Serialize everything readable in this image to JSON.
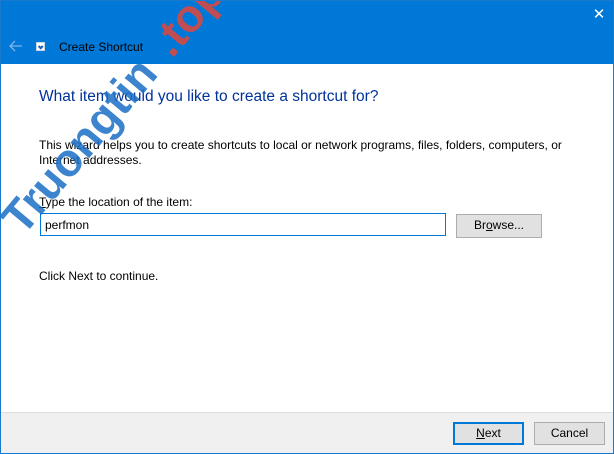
{
  "window": {
    "title": "Create Shortcut",
    "close_glyph": "✕",
    "back_icon": "back-arrow-icon",
    "app_icon": "shortcut-icon"
  },
  "main": {
    "heading": "What item would you like to create a shortcut for?",
    "description": "This wizard helps you to create shortcuts to local or network programs, files, folders, computers, or Internet addresses.",
    "location_label_mnemonic": "T",
    "location_label_rest": "ype the location of the item:",
    "location_value": "perfmon",
    "browse_mnemonic_pre": "Br",
    "browse_mnemonic": "o",
    "browse_mnemonic_post": "wse...",
    "continue_text": "Click Next to continue."
  },
  "footer": {
    "next_mnemonic": "N",
    "next_rest": "ext",
    "cancel_label": "Cancel"
  },
  "watermark": {
    "text_blue": "Truongtin",
    "text_red": ".top"
  },
  "colors": {
    "titlebar": "#0078d7",
    "heading": "#003399",
    "watermark_blue": "#1a6fc4",
    "watermark_red": "#e0453a"
  }
}
